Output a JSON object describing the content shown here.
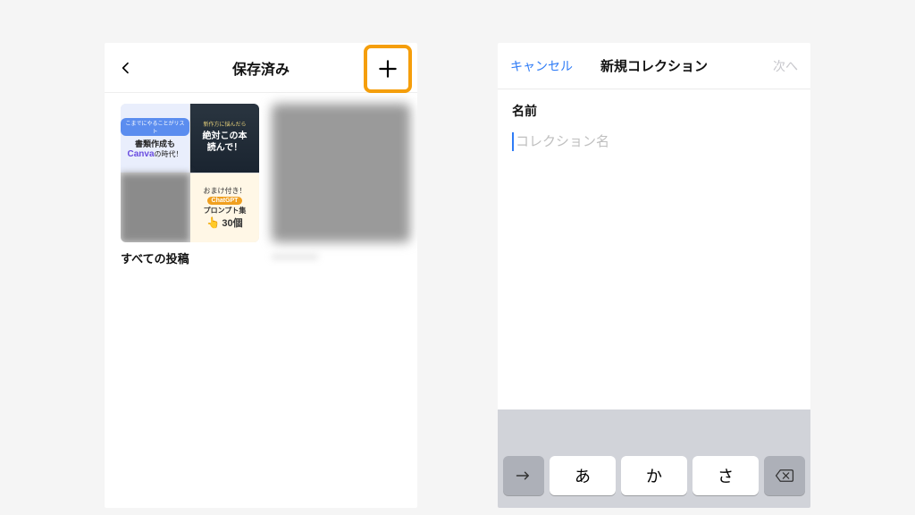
{
  "left": {
    "title": "保存済み",
    "collection1_label": "すべての投稿",
    "thumb1": {
      "pill": "こまでにやることがリスト",
      "line1": "書類作成も",
      "line2a": "Canva",
      "line2b": "の時代！"
    },
    "thumb2": {
      "small": "新作方に悩んだら",
      "line1": "絶対この本",
      "line2": "読んで！"
    },
    "thumb4": {
      "line1": "おまけ付き！",
      "tag": "ChatGPT",
      "line2": "プロンプト集",
      "count": "30個"
    }
  },
  "right": {
    "cancel": "キャンセル",
    "title": "新規コレクション",
    "next": "次へ",
    "field_label": "名前",
    "placeholder": "コレクション名",
    "keys": {
      "k1": "あ",
      "k2": "か",
      "k3": "さ"
    }
  }
}
